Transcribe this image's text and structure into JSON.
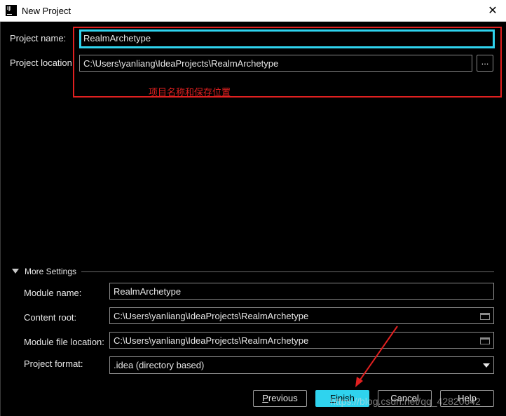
{
  "window": {
    "title": "New Project",
    "close_glyph": "✕",
    "app_icon_text": "IJ"
  },
  "project": {
    "name_label": "Project name:",
    "name_value": "RealmArchetype",
    "location_label": "Project location:",
    "location_value": "C:\\Users\\yanliang\\IdeaProjects\\RealmArchetype",
    "browse_label": "..."
  },
  "annotation": {
    "text": "项目名称和保存位置",
    "color": "#e02020"
  },
  "more_settings": {
    "title": "More Settings",
    "module_name_label": "Module name:",
    "module_name_value": "RealmArchetype",
    "content_root_label": "Content root:",
    "content_root_value": "C:\\Users\\yanliang\\IdeaProjects\\RealmArchetype",
    "module_file_label": "Module file location:",
    "module_file_value": "C:\\Users\\yanliang\\IdeaProjects\\RealmArchetype",
    "format_label": "Project format:",
    "format_value": ".idea (directory based)"
  },
  "buttons": {
    "previous_mnemonic": "P",
    "previous_rest": "revious",
    "finish_mnemonic": "F",
    "finish_rest": "inish",
    "cancel": "Cancel",
    "help": "Help"
  },
  "watermark": "https://blog.csdn.net/qq_42820642",
  "colors": {
    "accent": "#2fd3ee",
    "annotation": "#e02020",
    "background": "#000000"
  }
}
